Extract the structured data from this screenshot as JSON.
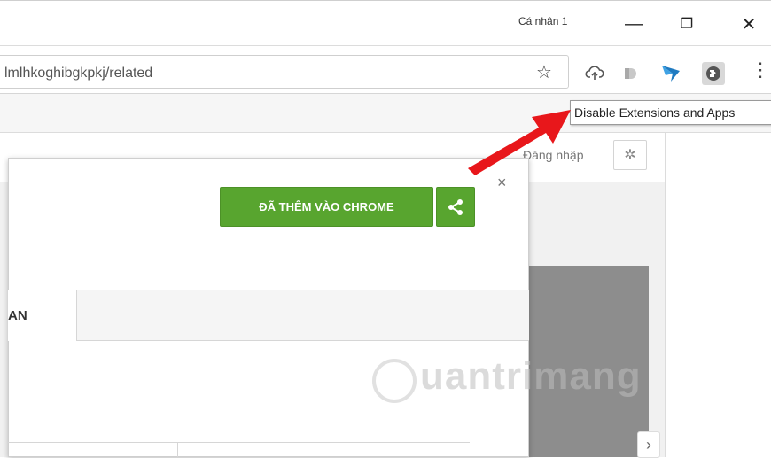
{
  "window": {
    "profile_name": "Cá nhân 1",
    "minimize_glyph": "—",
    "restore_glyph": "❐",
    "close_glyph": "✕"
  },
  "toolbar": {
    "url_text": "lmlhkoghibgkpkj/related",
    "star_glyph": "☆",
    "menu_glyph": "⋮",
    "extensions": [
      "cloud-upload-icon",
      "grey-puzzle-icon",
      "blue-bird-icon",
      "disable-extensions-icon"
    ]
  },
  "tooltip": {
    "text": "Disable Extensions and Apps"
  },
  "page": {
    "signin_text": "Đăng nhập",
    "gear_glyph": "✲",
    "next_glyph": "›"
  },
  "dialog": {
    "close_glyph": "×",
    "added_button_label": "ĐÃ THÊM VÀO CHROME",
    "tab_label": "AN"
  },
  "watermark": {
    "text": "uantrimang"
  },
  "colors": {
    "accent_green": "#58a52f",
    "arrow_red": "#e8171b",
    "ext_blue": "#1f7ac0"
  }
}
